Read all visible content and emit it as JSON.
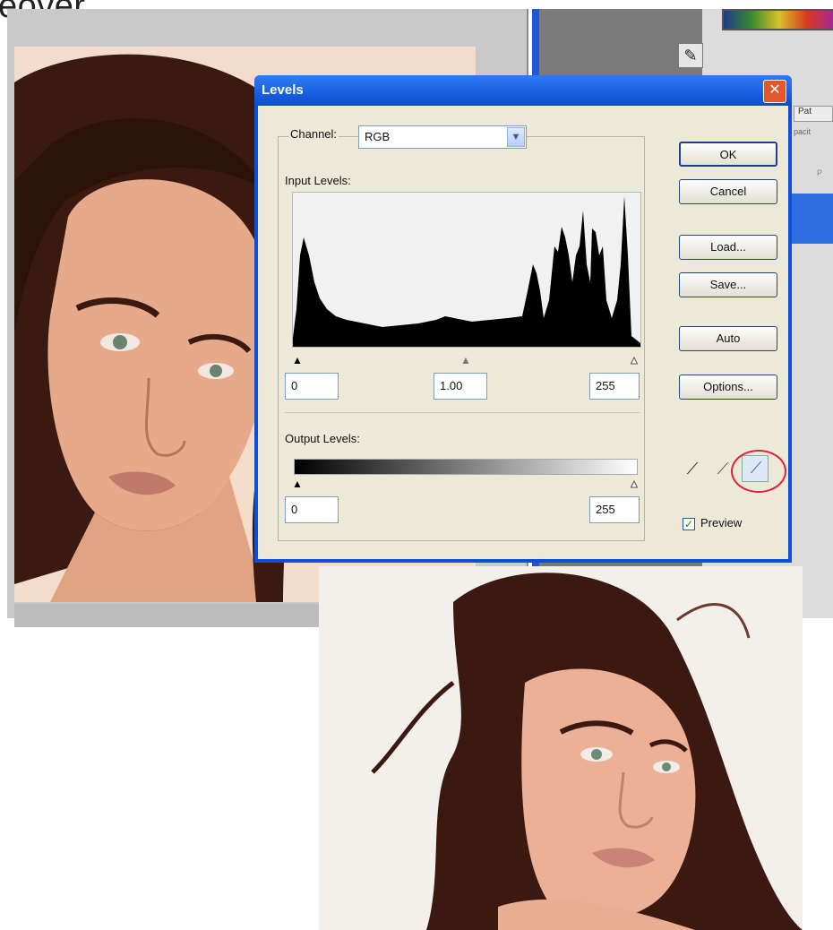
{
  "slide": {
    "heading_fragment": "eover"
  },
  "background_window": {
    "panel_tab_label": "Pat",
    "panel_text_1": "pacit",
    "panel_text_2": "P"
  },
  "dialog": {
    "title": "Levels",
    "close_glyph": "✕",
    "channel_label": "Channel:",
    "channel_value": "RGB",
    "input_levels_label": "Input Levels:",
    "input_black": "0",
    "input_gamma": "1.00",
    "input_white": "255",
    "output_levels_label": "Output Levels:",
    "output_black": "0",
    "output_white": "255",
    "buttons": {
      "ok": "OK",
      "cancel": "Cancel",
      "load": "Load...",
      "save": "Save...",
      "auto": "Auto",
      "options": "Options..."
    },
    "preview_label": "Preview",
    "preview_checked": true
  },
  "icons": {
    "eyedropper_black": "eyedropper-black-icon",
    "eyedropper_gray": "eyedropper-gray-icon",
    "eyedropper_white": "eyedropper-white-icon"
  },
  "colors": {
    "title_bar": "#0a4bd3",
    "dialog_body": "#ece9d8",
    "highlight": "#e0203a",
    "panel_blue": "#1f57d6"
  }
}
